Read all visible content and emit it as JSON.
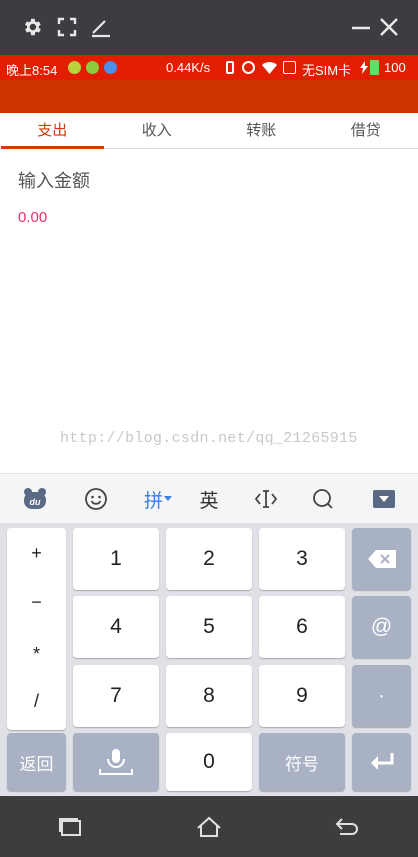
{
  "status_bar": {
    "time": "晚上8:54",
    "speed": "0.44K/s",
    "sim": "无SIM卡",
    "battery": "100"
  },
  "tabs": [
    {
      "label": "支出",
      "active": true
    },
    {
      "label": "收入",
      "active": false
    },
    {
      "label": "转账",
      "active": false
    },
    {
      "label": "借贷",
      "active": false
    }
  ],
  "amount": {
    "label": "输入金额",
    "value": "0.00"
  },
  "watermark": "http://blog.csdn.net/qq_21265915",
  "ime": {
    "pinyin_label": "拼",
    "english_label": "英"
  },
  "keyboard": {
    "symbols": [
      "+",
      "−",
      "*",
      "/"
    ],
    "digits": [
      "1",
      "2",
      "3",
      "4",
      "5",
      "6",
      "7",
      "8",
      "9",
      "0"
    ],
    "at": "@",
    "dot": "·",
    "back_label": "返回",
    "symbols_label": "符号"
  },
  "colors": {
    "accent": "#d03a10",
    "status_bar": "#e11e00",
    "amount_value": "#e0306a",
    "ime_accent": "#3b7fe0"
  }
}
